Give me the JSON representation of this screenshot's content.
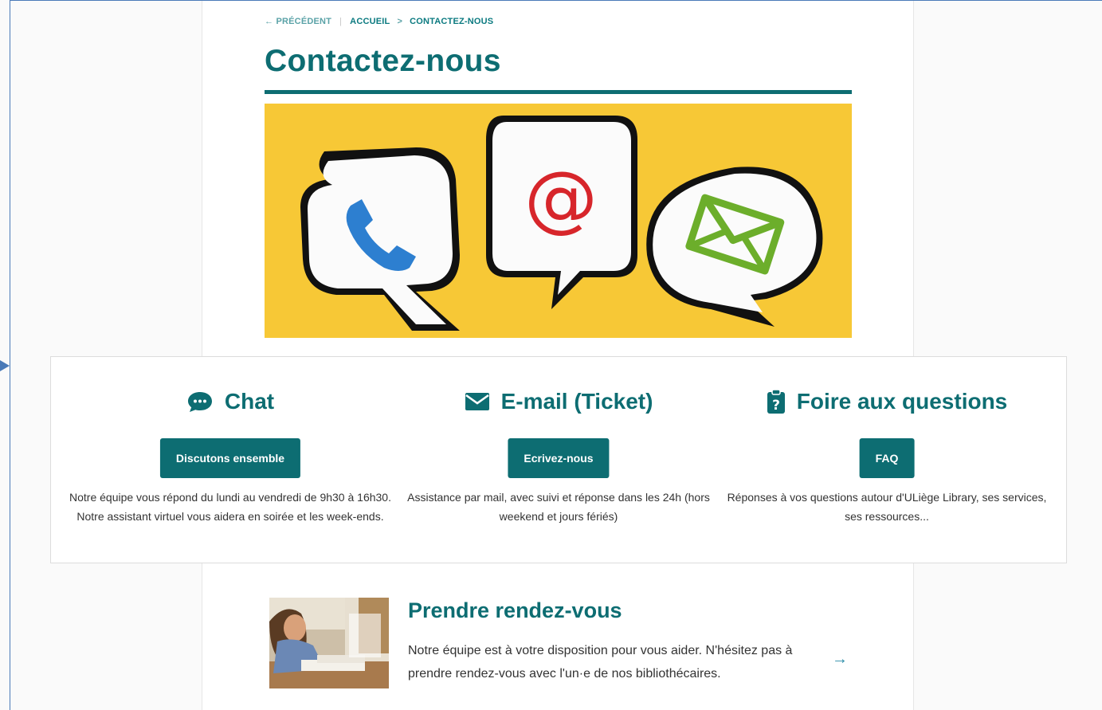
{
  "breadcrumb": {
    "previous": "← PRÉCÉDENT",
    "home": "ACCUEIL",
    "separator": ">",
    "current": "CONTACTEZ-NOUS"
  },
  "page": {
    "title": "Contactez-nous",
    "hero_icons": [
      "phone-icon",
      "at-sign-icon",
      "envelope-icon"
    ]
  },
  "contact_options": {
    "chat": {
      "title": "Chat",
      "icon": "chat-bubble-icon",
      "button": "Discutons ensemble",
      "description": "Notre équipe vous répond du lundi au vendredi de 9h30 à 16h30. Notre assistant virtuel vous aidera en soirée et les week-ends."
    },
    "email": {
      "title": "E-mail (Ticket)",
      "icon": "envelope-icon",
      "button": "Ecrivez-nous",
      "description": "Assistance par mail, avec suivi et réponse dans les 24h (hors weekend et jours fériés)"
    },
    "faq": {
      "title": "Foire aux questions",
      "icon": "question-clipboard-icon",
      "button": "FAQ",
      "description": "Réponses à vos questions autour d'ULiège Library, ses services, ses ressources..."
    }
  },
  "appointment": {
    "title": "Prendre rendez-vous",
    "text": "Notre équipe est à votre disposition pour vous aider. N'hésitez pas à prendre rendez-vous avec l'un·e de nos bibliothécaires.",
    "arrow": "→"
  },
  "colors": {
    "brand": "#0d6d72",
    "hero_background": "#f6c22c",
    "link_arrow": "#2a8ca8"
  }
}
